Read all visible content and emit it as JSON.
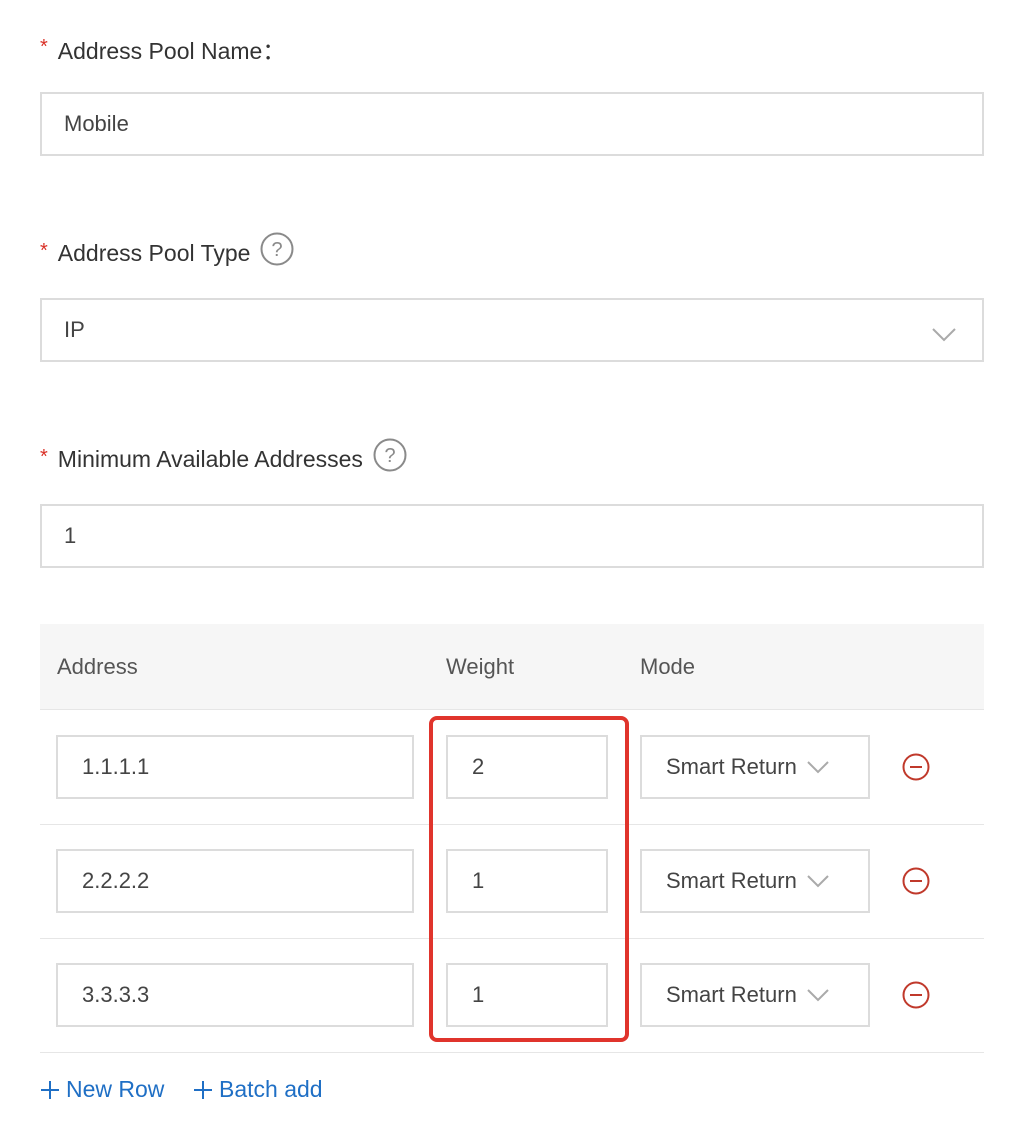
{
  "form": {
    "required_mark": "*",
    "pool_name": {
      "label": "Address Pool Name：",
      "value": "Mobile"
    },
    "pool_type": {
      "label": "Address Pool Type",
      "value": "IP",
      "help_icon": "question-circle-icon",
      "dropdown_icon": "chevron-down-icon"
    },
    "min_addresses": {
      "label": "Minimum Available Addresses",
      "value": "1",
      "help_icon": "question-circle-icon"
    }
  },
  "table": {
    "columns": {
      "address": "Address",
      "weight": "Weight",
      "mode": "Mode"
    },
    "rows": [
      {
        "address": "1.1.1.1",
        "weight": "2",
        "mode": "Smart Return"
      },
      {
        "address": "2.2.2.2",
        "weight": "1",
        "mode": "Smart Return"
      },
      {
        "address": "3.3.3.3",
        "weight": "1",
        "mode": "Smart Return"
      }
    ],
    "remove_icon": "minus-circle-icon"
  },
  "actions": {
    "new_row": "New Row",
    "batch_add": "Batch add"
  },
  "colors": {
    "required": "#d93026",
    "link": "#1f6fc5",
    "highlight": "#e0342c",
    "remove": "#c0392b",
    "header_bg": "#f6f6f6",
    "border": "#dcdcdc"
  }
}
